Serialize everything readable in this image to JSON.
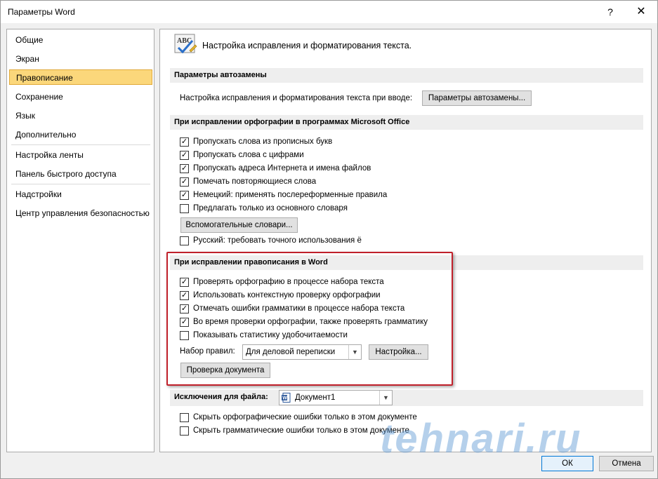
{
  "window": {
    "title": "Параметры Word",
    "help_label": "?",
    "close_label": "✕"
  },
  "nav": {
    "items": [
      {
        "label": "Общие"
      },
      {
        "label": "Экран"
      },
      {
        "label": "Правописание",
        "selected": true
      },
      {
        "label": "Сохранение"
      },
      {
        "label": "Язык"
      },
      {
        "label": "Дополнительно"
      },
      {
        "label": "Настройка ленты"
      },
      {
        "label": "Панель быстрого доступа"
      },
      {
        "label": "Надстройки"
      },
      {
        "label": "Центр управления безопасностью"
      }
    ]
  },
  "main": {
    "icon_text": "ABC",
    "header": "Настройка исправления и форматирования текста.",
    "autocorrect": {
      "section_title": "Параметры автозамены",
      "row_label": "Настройка исправления и форматирования текста при вводе:",
      "button_label": "Параметры автозамены..."
    },
    "office_spelling": {
      "section_title": "При исправлении орфографии в программах Microsoft Office",
      "options": [
        {
          "label": "Пропускать слова из прописных букв",
          "checked": true
        },
        {
          "label": "Пропускать слова с цифрами",
          "checked": true
        },
        {
          "label": "Пропускать адреса Интернета и имена файлов",
          "checked": true
        },
        {
          "label": "Помечать повторяющиеся слова",
          "checked": true
        },
        {
          "label": "Немецкий: применять послереформенные правила",
          "checked": true
        },
        {
          "label": "Предлагать только из основного словаря",
          "checked": false
        }
      ],
      "dictionaries_button": "Вспомогательные словари...",
      "russian_option": {
        "label": "Русский: требовать точного использования ё",
        "checked": false
      }
    },
    "word_spelling": {
      "section_title": "При исправлении правописания в Word",
      "options": [
        {
          "label": "Проверять орфографию в процессе набора текста",
          "checked": true
        },
        {
          "label": "Использовать контекстную проверку орфографии",
          "checked": true
        },
        {
          "label": "Отмечать ошибки грамматики в процессе набора текста",
          "checked": true
        },
        {
          "label": "Во время проверки орфографии, также проверять грамматику",
          "checked": true
        },
        {
          "label": "Показывать статистику удобочитаемости",
          "checked": false
        }
      ],
      "ruleset_label": "Набор правил:",
      "ruleset_value": "Для деловой переписки",
      "settings_button": "Настройка...",
      "check_document_button": "Проверка документа"
    },
    "exceptions": {
      "label": "Исключения для файла:",
      "file_value": "Документ1",
      "options": [
        {
          "label": "Скрыть орфографические ошибки только в этом документе",
          "checked": false
        },
        {
          "label": "Скрыть грамматические ошибки только в этом документе",
          "checked": false
        }
      ]
    }
  },
  "footer": {
    "ok_label": "ОК",
    "cancel_label": "Отмена"
  },
  "watermark": "tehnari.ru",
  "colors": {
    "selected_bg": "#fbd77b",
    "highlight_border": "#c0202a",
    "ok_border": "#0078d7"
  }
}
